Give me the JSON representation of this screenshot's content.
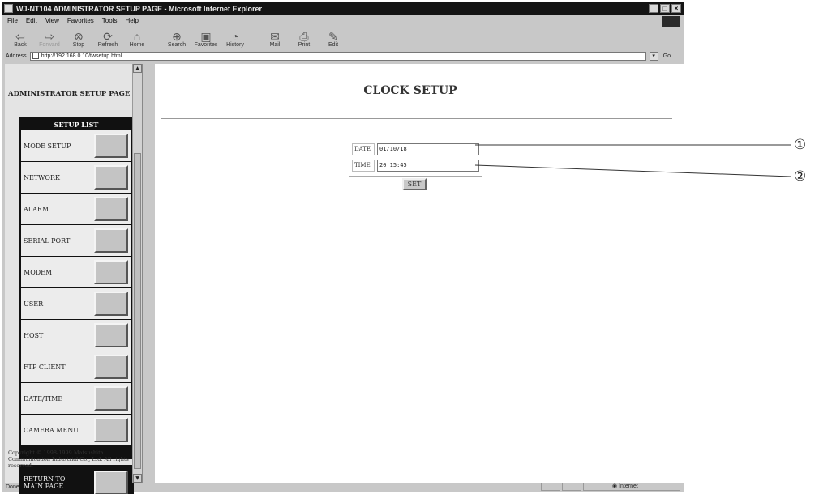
{
  "window": {
    "title": "WJ-NT104 ADMINISTRATOR SETUP PAGE - Microsoft Internet Explorer",
    "controls": [
      "_",
      "□",
      "×"
    ]
  },
  "menu": [
    "File",
    "Edit",
    "View",
    "Favorites",
    "Tools",
    "Help"
  ],
  "toolbar": [
    {
      "label": "Back",
      "icon": "back-arrow-icon",
      "glyph": "⇦",
      "enabled": true
    },
    {
      "label": "Forward",
      "icon": "forward-arrow-icon",
      "glyph": "⇨",
      "enabled": false
    },
    {
      "label": "Stop",
      "icon": "stop-icon",
      "glyph": "⊗",
      "enabled": true
    },
    {
      "label": "Refresh",
      "icon": "refresh-icon",
      "glyph": "⟳",
      "enabled": true
    },
    {
      "label": "Home",
      "icon": "home-icon",
      "glyph": "⌂",
      "enabled": true
    },
    {
      "label": "Search",
      "icon": "search-icon",
      "glyph": "⊕",
      "enabled": true
    },
    {
      "label": "Favorites",
      "icon": "favorites-icon",
      "glyph": "▣",
      "enabled": true
    },
    {
      "label": "History",
      "icon": "history-icon",
      "glyph": "◔",
      "enabled": true
    },
    {
      "label": "Mail",
      "icon": "mail-icon",
      "glyph": "✉",
      "enabled": true
    },
    {
      "label": "Print",
      "icon": "print-icon",
      "glyph": "⎙",
      "enabled": true
    },
    {
      "label": "Edit",
      "icon": "edit-icon",
      "glyph": "✎",
      "enabled": true
    }
  ],
  "address": {
    "label": "Address",
    "url": "http://192.168.0.10/twsetup.html",
    "go": "Go"
  },
  "sidebar": {
    "title": "ADMINISTRATOR SETUP PAGE",
    "list_header": "SETUP LIST",
    "items": [
      {
        "label": "MODE SETUP"
      },
      {
        "label": "NETWORK"
      },
      {
        "label": "ALARM"
      },
      {
        "label": "SERIAL PORT"
      },
      {
        "label": "MODEM"
      },
      {
        "label": "USER"
      },
      {
        "label": "HOST"
      },
      {
        "label": "FTP CLIENT"
      },
      {
        "label": "DATE/TIME"
      },
      {
        "label": "CAMERA MENU"
      }
    ],
    "return_label": "RETURN TO MAIN PAGE",
    "copyright": "Copyright © 1998-1999 Matsushita Communication Industrial Co., Ltd. All rights reserved."
  },
  "main": {
    "title": "CLOCK SETUP",
    "date_label": "DATE",
    "date_value": "01/10/18",
    "time_label": "TIME",
    "time_value": "20:15:45",
    "set_label": "SET"
  },
  "status": {
    "text": "Done",
    "zone": "Internet"
  },
  "callouts": [
    "①",
    "②"
  ]
}
